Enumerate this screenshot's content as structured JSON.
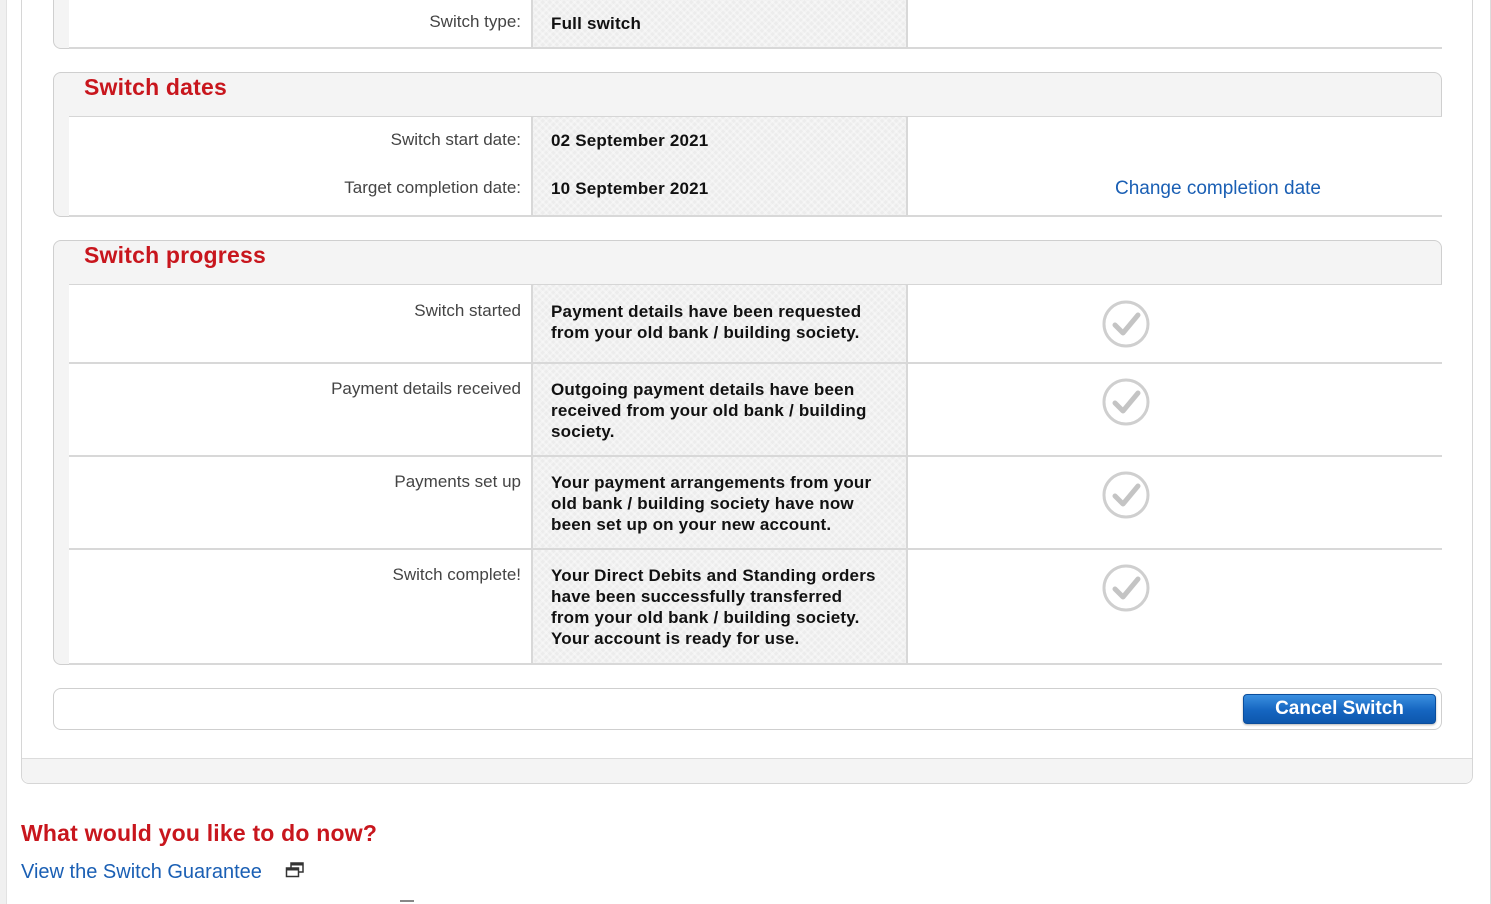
{
  "switch_type": {
    "label": "Switch type:",
    "value": "Full switch"
  },
  "switch_dates": {
    "title": "Switch dates",
    "start_label": "Switch start date:",
    "start_value": "02 September 2021",
    "target_label": "Target completion date:",
    "target_value": "10 September 2021",
    "change_link": "Change completion date"
  },
  "switch_progress": {
    "title": "Switch progress",
    "steps": [
      {
        "label": "Switch started",
        "lines": [
          "Payment details have been requested",
          "from your old bank / building society."
        ],
        "icon": "checkmark-circle-icon"
      },
      {
        "label": "Payment details received",
        "lines": [
          "Outgoing payment details have been",
          "received from your old bank / building",
          "society."
        ],
        "icon": "checkmark-circle-icon"
      },
      {
        "label": "Payments set up",
        "lines": [
          "Your payment arrangements from your",
          "old bank / building society have now",
          "been set up on your new account."
        ],
        "icon": "checkmark-circle-icon"
      },
      {
        "label": "Switch complete!",
        "lines": [
          "Your Direct Debits and Standing orders",
          "have been successfully transferred",
          "from your old bank / building society.",
          "Your account is ready for use."
        ],
        "icon": "checkmark-circle-icon"
      }
    ]
  },
  "actions": {
    "cancel_label": "Cancel Switch"
  },
  "next_steps": {
    "title": "What would you like to do now?",
    "guarantee_link": "View the Switch Guarantee",
    "guarantee_icon": "new-window-icon"
  },
  "colors": {
    "heading_red": "#c8161d",
    "link_blue": "#1a5fb4",
    "button_blue": "#1565c0"
  }
}
